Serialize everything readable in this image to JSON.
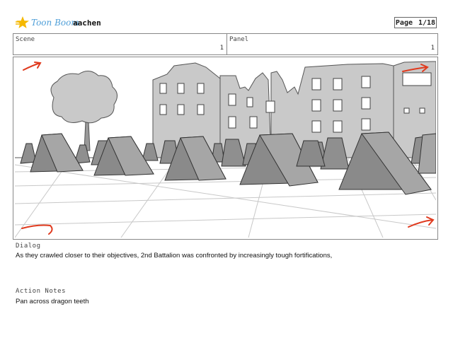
{
  "header": {
    "brand": "Toon Boom",
    "project": "aachen",
    "page_label": "Page",
    "page_value": "1/18"
  },
  "scene": {
    "label": "Scene",
    "value": "1"
  },
  "panel": {
    "label": "Panel",
    "value": "1"
  },
  "dialog": {
    "label": "Dialog",
    "text": "As they crawled closer to their objectives, 2nd Battalion was confronted by increasingly tough fortifications,"
  },
  "action_notes": {
    "label": "Action Notes",
    "text": "Pan across dragon teeth"
  },
  "icons": {
    "logo": "toon-boom-star-logo",
    "arrows": "camera-pan-arrow-icon"
  },
  "colors": {
    "brand": "#4f9fd8",
    "logo_star": "#f5b800",
    "arrow": "#e03a1e"
  }
}
